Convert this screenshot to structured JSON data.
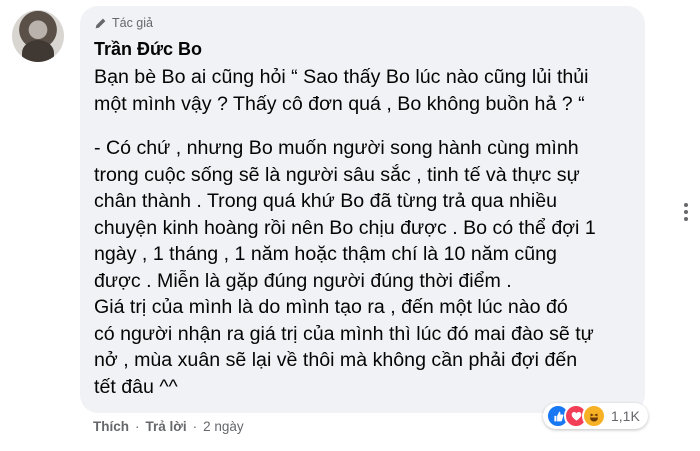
{
  "comment": {
    "author_badge": "Tác giả",
    "author_name": "Trần Đức Bo",
    "paragraphs": [
      "Bạn bè Bo ai cũng hỏi “ Sao thấy Bo lúc nào cũng lủi thủi\nmột mình vậy ? Thấy cô đơn quá , Bo không buồn hả ? “",
      "- Có chứ , nhưng Bo muốn người song hành cùng mình\ntrong cuộc sống sẽ là người sâu sắc , tinh tế và thực sự\nchân thành . Trong quá khứ Bo đã từng trả qua nhiều\nchuyện kinh hoàng rồi nên Bo chịu được . Bo có thể đợi 1\nngày , 1 tháng , 1 năm hoặc thậm chí là 10 năm cũng\nđược . Miễn là gặp đúng người đúng thời điểm .\nGiá trị của mình là do mình tạo ra , đến một lúc nào đó\ncó người nhận ra giá trị của mình thì lúc đó mai đào sẽ tự\nnở , mùa xuân sẽ lại về thôi mà không cần phải đợi đến\ntết đâu ^^"
    ],
    "reactions": {
      "icons": [
        "like-icon",
        "love-icon",
        "haha-icon"
      ],
      "count": "1,1K"
    },
    "actions": {
      "like": "Thích",
      "reply": "Trả lời",
      "separator": "·",
      "time": "2 ngày"
    }
  },
  "colors": {
    "bubble": "#f0f2f5",
    "text": "#050505",
    "secondary": "#65676b",
    "like": "#1877f2",
    "love": "#f33e58",
    "haha": "#f7b125"
  }
}
